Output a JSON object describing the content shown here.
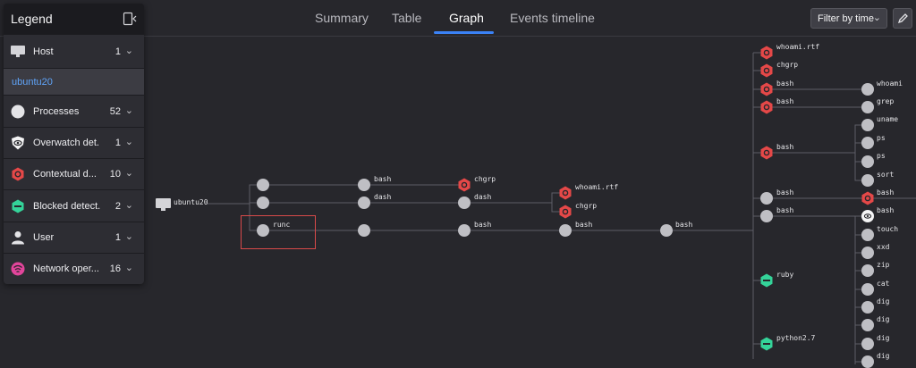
{
  "tabs": [
    {
      "label": "Summary",
      "active": false
    },
    {
      "label": "Table",
      "active": false
    },
    {
      "label": "Graph",
      "active": true
    },
    {
      "label": "Events timeline",
      "active": false
    }
  ],
  "filter": {
    "label": "Filter by time"
  },
  "legend": {
    "title": "Legend",
    "items": [
      {
        "label": "Host",
        "count": "1",
        "icon": "monitor-icon"
      },
      {
        "label": "Processes",
        "count": "52",
        "icon": "circle-icon"
      },
      {
        "label": "Overwatch det...",
        "count": "1",
        "icon": "overwatch-eye-icon"
      },
      {
        "label": "Contextual d...",
        "count": "10",
        "icon": "red-hexagon-icon"
      },
      {
        "label": "Blocked detect...",
        "count": "2",
        "icon": "green-hexagon-icon"
      },
      {
        "label": "User",
        "count": "1",
        "icon": "user-icon"
      },
      {
        "label": "Network oper...",
        "count": "16",
        "icon": "network-icon"
      }
    ],
    "host_name": "ubuntu20"
  },
  "graph": {
    "host_label": "ubuntu20",
    "nodes": [
      {
        "id": "n_a1",
        "label": "",
        "type": "process"
      },
      {
        "id": "n_a2",
        "label": "",
        "type": "process"
      },
      {
        "id": "n_runc",
        "label": "runc",
        "type": "process"
      },
      {
        "id": "n_b1",
        "label": "bash",
        "type": "process"
      },
      {
        "id": "n_b2",
        "label": "dash",
        "type": "process"
      },
      {
        "id": "n_b3",
        "label": "",
        "type": "process"
      },
      {
        "id": "n_c1",
        "label": "chgrp",
        "type": "contextual"
      },
      {
        "id": "n_c2",
        "label": "dash",
        "type": "process"
      },
      {
        "id": "n_c3",
        "label": "bash",
        "type": "process"
      },
      {
        "id": "n_d1",
        "label": "whoami.rtf",
        "type": "contextual"
      },
      {
        "id": "n_d2",
        "label": "chgrp",
        "type": "contextual"
      },
      {
        "id": "n_d3",
        "label": "bash",
        "type": "process"
      },
      {
        "id": "n_e1",
        "label": "bash",
        "type": "process"
      },
      {
        "id": "n_f1",
        "label": "whoami.rtf",
        "type": "contextual"
      },
      {
        "id": "n_f2",
        "label": "chgrp",
        "type": "contextual"
      },
      {
        "id": "n_f3",
        "label": "bash",
        "type": "contextual"
      },
      {
        "id": "n_f4",
        "label": "bash",
        "type": "contextual"
      },
      {
        "id": "n_f5",
        "label": "bash",
        "type": "contextual"
      },
      {
        "id": "n_f6",
        "label": "bash",
        "type": "process"
      },
      {
        "id": "n_f7",
        "label": "bash",
        "type": "process"
      },
      {
        "id": "n_f8",
        "label": "ruby",
        "type": "blocked"
      },
      {
        "id": "n_f9",
        "label": "python2.7",
        "type": "blocked"
      },
      {
        "id": "n_g1",
        "label": "whoami",
        "type": "process"
      },
      {
        "id": "n_g2",
        "label": "grep",
        "type": "process"
      },
      {
        "id": "n_g3",
        "label": "uname",
        "type": "process"
      },
      {
        "id": "n_g4",
        "label": "ps",
        "type": "process"
      },
      {
        "id": "n_g5",
        "label": "ps",
        "type": "process"
      },
      {
        "id": "n_g6",
        "label": "sort",
        "type": "process"
      },
      {
        "id": "n_g7",
        "label": "bash",
        "type": "contextual"
      },
      {
        "id": "n_g8",
        "label": "bash",
        "type": "overwatch"
      },
      {
        "id": "n_g9",
        "label": "touch",
        "type": "process"
      },
      {
        "id": "n_g10",
        "label": "xxd",
        "type": "process"
      },
      {
        "id": "n_g11",
        "label": "zip",
        "type": "process"
      },
      {
        "id": "n_g12",
        "label": "cat",
        "type": "process"
      },
      {
        "id": "n_g13",
        "label": "dig",
        "type": "process"
      },
      {
        "id": "n_g14",
        "label": "dig",
        "type": "process"
      },
      {
        "id": "n_g15",
        "label": "dig",
        "type": "process"
      },
      {
        "id": "n_g16",
        "label": "dig",
        "type": "process"
      }
    ]
  },
  "colors": {
    "accent": "#3b82f6",
    "contextual": "#e54848",
    "blocked": "#34d399",
    "process": "#bfbfc4",
    "highlight": "#d94a4a"
  }
}
